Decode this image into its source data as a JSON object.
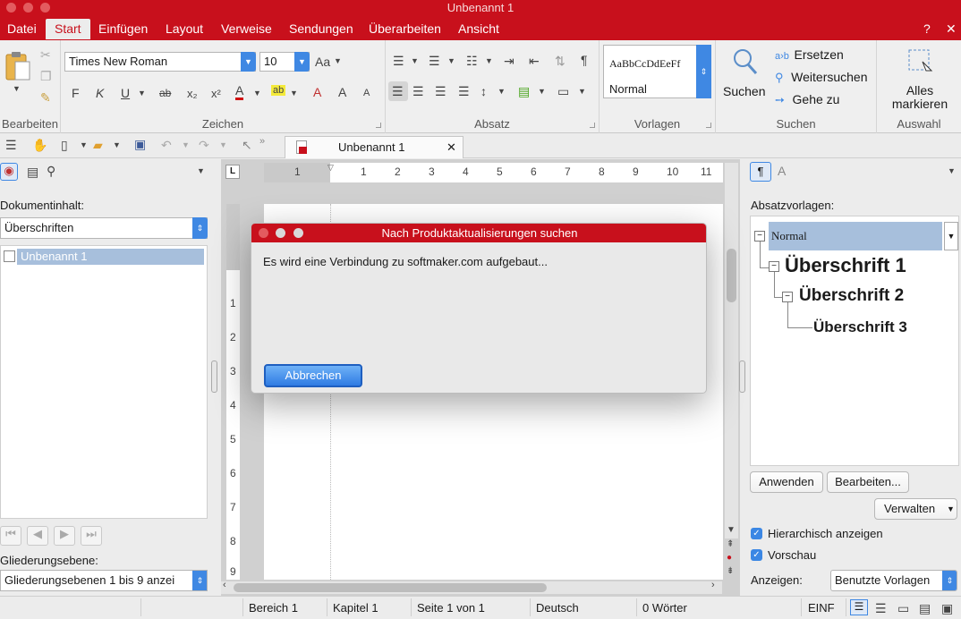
{
  "window": {
    "title": "Unbenannt 1"
  },
  "menu": {
    "items": [
      "Datei",
      "Start",
      "Einfügen",
      "Layout",
      "Verweise",
      "Sendungen",
      "Überarbeiten",
      "Ansicht"
    ],
    "help": "?",
    "close": "✕"
  },
  "ribbon": {
    "groups": {
      "bearbeiten": "Bearbeiten",
      "zeichen": "Zeichen",
      "absatz": "Absatz",
      "vorlagen": "Vorlagen",
      "suchen": "Suchen",
      "auswahl": "Auswahl"
    },
    "font_name": "Times New Roman",
    "font_size": "10",
    "bold": "F",
    "italic": "K",
    "underline": "U",
    "strike": "ab",
    "sub": "x₂",
    "sup": "x²",
    "style_preview_text": "AaBbCcDdEeFf",
    "style_preview_name": "Normal",
    "search_label": "Suchen",
    "replace_label": "Ersetzen",
    "continue_search_label": "Weitersuchen",
    "goto_label": "Gehe zu",
    "select_all_label": "Alles markieren"
  },
  "doc_tab": {
    "title": "Unbenannt 1",
    "close": "✕"
  },
  "left_panel": {
    "content_label": "Dokumentinhalt:",
    "content_select": "Überschriften",
    "tree_item": "Unbenannt 1",
    "outline_label": "Gliederungsebene:",
    "outline_select": "Gliederungsebenen 1 bis 9 anzei"
  },
  "ruler": {
    "h_numbers": [
      "1",
      "1",
      "2",
      "3",
      "4",
      "5",
      "6",
      "7",
      "8",
      "9",
      "10",
      "11"
    ],
    "v_numbers": [
      "1",
      "2",
      "3",
      "4",
      "5",
      "6",
      "7",
      "8",
      "9"
    ]
  },
  "dialog": {
    "title": "Nach Produktaktualisierungen suchen",
    "message": "Es wird eine Verbindung zu softmaker.com aufgebaut...",
    "cancel": "Abbrechen"
  },
  "right_panel": {
    "styles_label": "Absatzvorlagen:",
    "styles": [
      "Normal",
      "Überschrift 1",
      "Überschrift 2",
      "Überschrift 3"
    ],
    "apply": "Anwenden",
    "edit": "Bearbeiten...",
    "manage": "Verwalten",
    "hier_label": "Hierarchisch anzeigen",
    "preview_label": "Vorschau",
    "show_label": "Anzeigen:",
    "show_select": "Benutzte Vorlagen"
  },
  "status": {
    "area": "Bereich 1",
    "chapter": "Kapitel 1",
    "page": "Seite 1 von 1",
    "language": "Deutsch",
    "words": "0 Wörter",
    "mode": "EINF"
  }
}
